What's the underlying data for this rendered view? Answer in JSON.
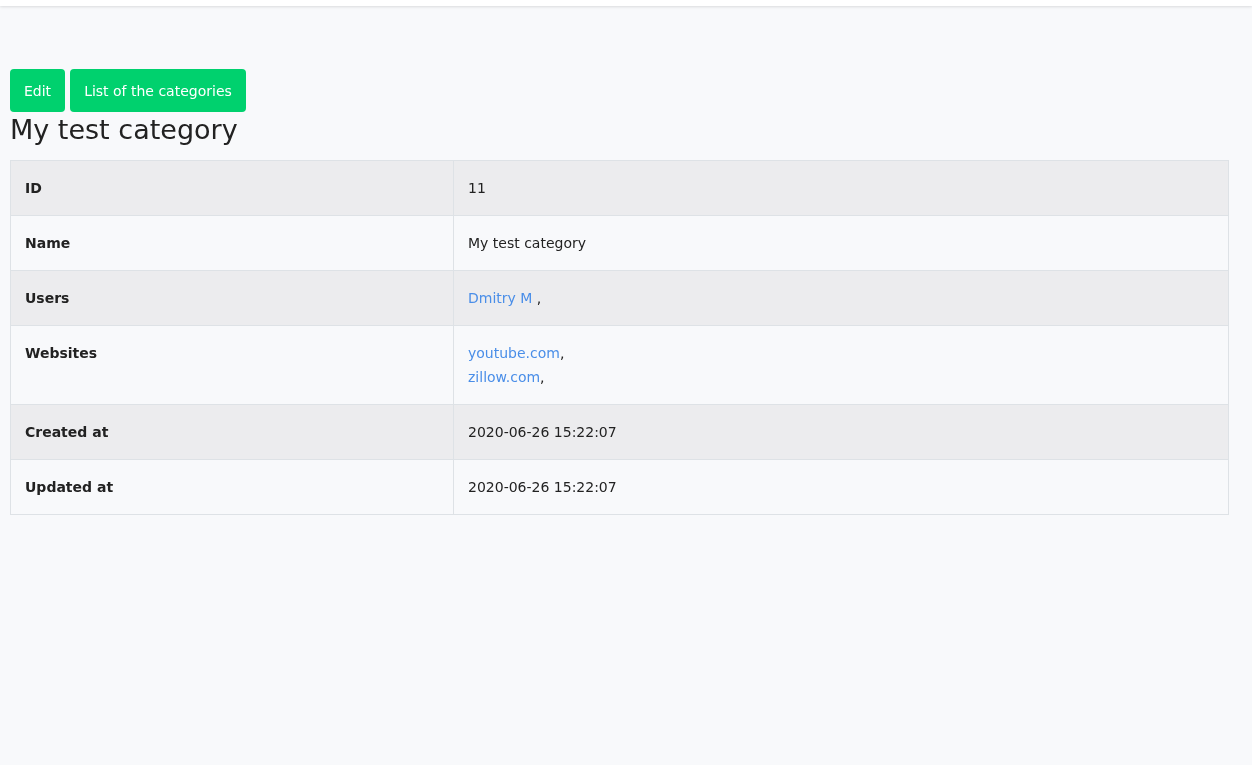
{
  "buttons": [
    {
      "label": "Edit"
    },
    {
      "label": "List of the categories"
    }
  ],
  "title": "My test category",
  "rows": [
    {
      "label": "ID",
      "lines": [
        [
          {
            "kind": "text",
            "text": "11"
          }
        ]
      ]
    },
    {
      "label": "Name",
      "lines": [
        [
          {
            "kind": "text",
            "text": "My test category"
          }
        ]
      ]
    },
    {
      "label": "Users",
      "lines": [
        [
          {
            "kind": "link",
            "text": "Dmitry M"
          },
          {
            "kind": "text",
            "text": " ,"
          }
        ]
      ]
    },
    {
      "label": "Websites",
      "lines": [
        [
          {
            "kind": "link",
            "text": "youtube.com"
          },
          {
            "kind": "text",
            "text": ","
          }
        ],
        [
          {
            "kind": "link",
            "text": "zillow.com"
          },
          {
            "kind": "text",
            "text": ","
          }
        ]
      ]
    },
    {
      "label": "Created at",
      "lines": [
        [
          {
            "kind": "text",
            "text": "2020-06-26 15:22:07"
          }
        ]
      ]
    },
    {
      "label": "Updated at",
      "lines": [
        [
          {
            "kind": "text",
            "text": "2020-06-26 15:22:07"
          }
        ]
      ]
    }
  ]
}
